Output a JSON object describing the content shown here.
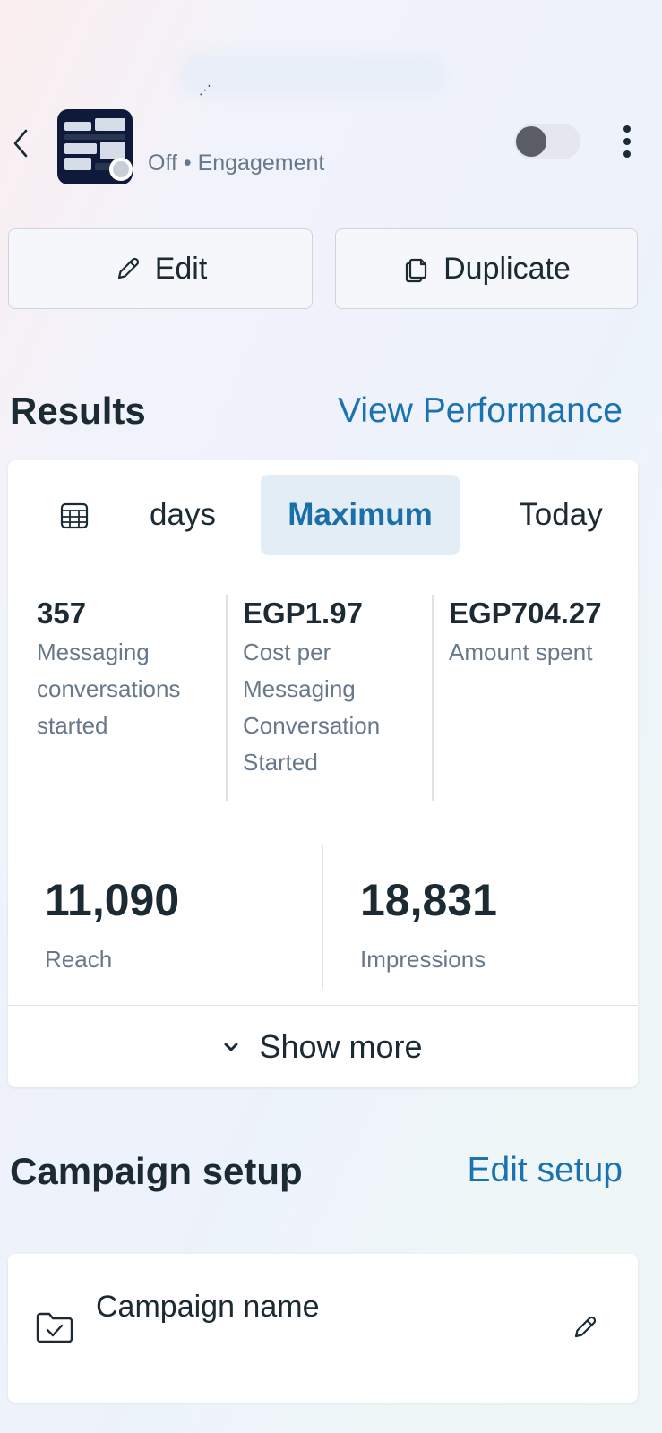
{
  "header": {
    "status": "Off",
    "separator": "•",
    "objective": "Engagement",
    "toggle_on": false
  },
  "actions": {
    "edit_label": "Edit",
    "duplicate_label": "Duplicate"
  },
  "results": {
    "title": "Results",
    "link": "View Performance",
    "tabs": [
      {
        "label": "days",
        "selected": false
      },
      {
        "label": "Maximum",
        "selected": true
      },
      {
        "label": "Today",
        "selected": false
      }
    ],
    "metrics": [
      {
        "value": "357",
        "label": "Messaging conversations started"
      },
      {
        "value": "EGP1.97",
        "label": "Cost per Messaging Conversation Started"
      },
      {
        "value": "EGP704.27",
        "label": "Amount spent"
      }
    ],
    "big_metrics": [
      {
        "value": "11,090",
        "label": "Reach"
      },
      {
        "value": "18,831",
        "label": "Impressions"
      }
    ],
    "show_more": "Show more"
  },
  "setup": {
    "title": "Campaign setup",
    "link": "Edit setup",
    "campaign_name_label": "Campaign name"
  },
  "icons": {
    "back": "chevron-left-icon",
    "more": "more-vertical-icon",
    "edit": "pencil-icon",
    "duplicate": "copy-icon",
    "calendar": "calendar-icon",
    "show_more": "chevron-down-icon",
    "folder": "folder-check-icon"
  },
  "colors": {
    "accent": "#1a73b0",
    "selected_tab_bg": "#e3edf6",
    "text": "#1c2b33",
    "muted": "#67788a"
  }
}
